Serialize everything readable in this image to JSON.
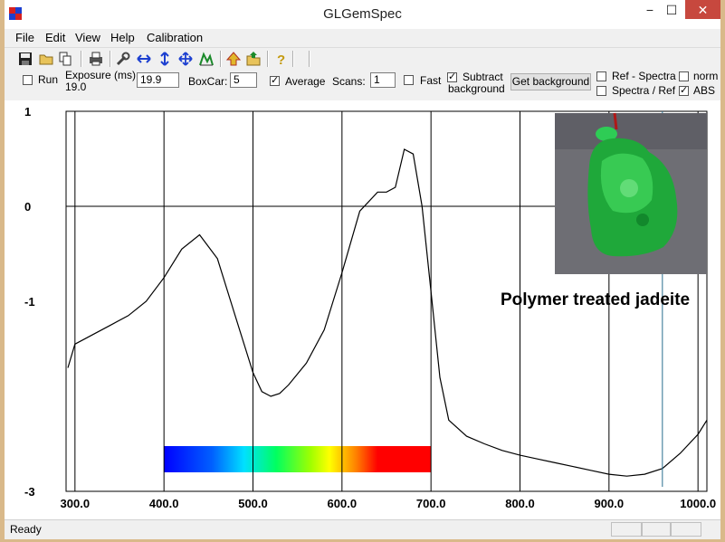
{
  "window": {
    "title": "GLGemSpec",
    "minimize_label": "−",
    "maximize_label": "☐",
    "close_label": "✕"
  },
  "menu": [
    "File",
    "Edit",
    "View",
    "Help",
    "Calibration"
  ],
  "toolbar": {
    "icons": [
      "save-icon",
      "open-icon",
      "copy-icon",
      "print-icon",
      "wrench-icon",
      "horizontal-arrows-icon",
      "vertical-arrows-icon",
      "move-arrows-icon",
      "peak-icon",
      "up-arrow-icon",
      "open-folder-icon",
      "help-icon"
    ]
  },
  "controls": {
    "run_label": "Run",
    "run_checked": false,
    "exposure_label": "Exposure (ms):",
    "exposure_value_label": "19.0",
    "exposure_input": "19.9",
    "boxcar_label": "BoxCar:",
    "boxcar_input": "5",
    "average_label": "Average",
    "average_checked": true,
    "scans_label": "Scans:",
    "scans_input": "1",
    "fast_label": "Fast",
    "fast_checked": false,
    "subtract_label_1": "Subtract",
    "subtract_label_2": "background",
    "subtract_checked": true,
    "get_background_button": "Get background",
    "ref_spectra_label": "Ref - Spectra",
    "ref_spectra_checked": false,
    "spectra_ref_label": "Spectra / Ref",
    "spectra_ref_checked": false,
    "norm_label": "norm",
    "norm_checked": false,
    "abs_label": "ABS",
    "abs_checked": true
  },
  "annotation": "Polymer treated jadeite",
  "status": {
    "text": "Ready"
  },
  "colors": {
    "accent_cursor": "#2a6f8f",
    "gem": "#1fa83a"
  },
  "chart_data": {
    "type": "line",
    "title": "",
    "xlabel": "",
    "ylabel": "",
    "xlim": [
      290,
      1010
    ],
    "ylim": [
      -3,
      1
    ],
    "x_ticks": [
      300,
      400,
      500,
      600,
      700,
      800,
      900,
      1000
    ],
    "x_tick_labels": [
      "300.0",
      "400.0",
      "500.0",
      "600.0",
      "700.0",
      "800.0",
      "900.0",
      "1000.0"
    ],
    "y_ticks": [
      1,
      0,
      -1,
      -3
    ],
    "y_tick_labels": [
      "1",
      "0",
      "-1",
      "-3"
    ],
    "grid": true,
    "cursor_x": 960,
    "spectrum_band": {
      "from": 400,
      "to": 700
    },
    "series": [
      {
        "name": "",
        "x": [
          292,
          300,
          320,
          340,
          360,
          380,
          400,
          420,
          440,
          460,
          480,
          500,
          510,
          520,
          530,
          540,
          560,
          580,
          600,
          620,
          640,
          650,
          660,
          670,
          680,
          690,
          700,
          710,
          720,
          740,
          760,
          780,
          800,
          820,
          840,
          860,
          880,
          900,
          920,
          940,
          960,
          980,
          1000,
          1010
        ],
        "y": [
          -1.7,
          -1.45,
          -1.35,
          -1.25,
          -1.15,
          -1.0,
          -0.75,
          -0.45,
          -0.3,
          -0.55,
          -1.15,
          -1.75,
          -1.95,
          -2.0,
          -1.97,
          -1.88,
          -1.65,
          -1.3,
          -0.7,
          -0.05,
          0.15,
          0.15,
          0.2,
          0.6,
          0.55,
          0.0,
          -0.9,
          -1.8,
          -2.25,
          -2.42,
          -2.5,
          -2.57,
          -2.62,
          -2.66,
          -2.7,
          -2.74,
          -2.78,
          -2.82,
          -2.84,
          -2.82,
          -2.76,
          -2.6,
          -2.4,
          -2.25
        ]
      }
    ]
  }
}
